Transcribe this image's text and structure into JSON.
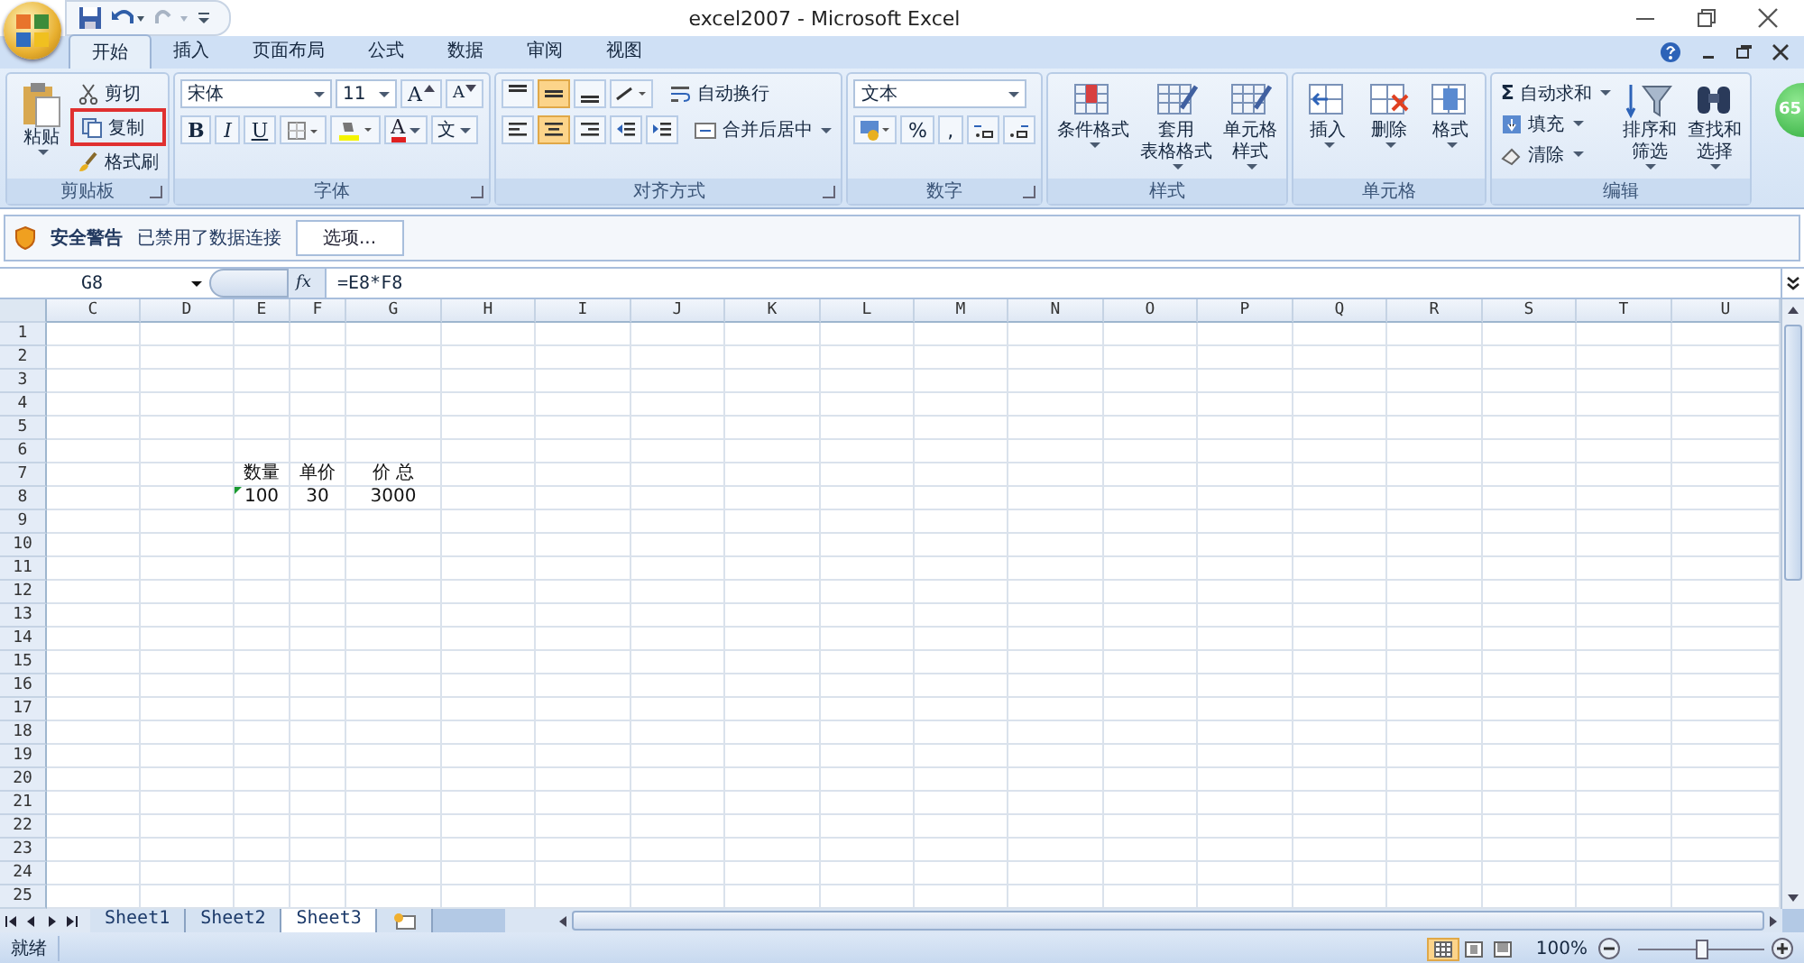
{
  "window": {
    "title": "excel2007 - Microsoft Excel"
  },
  "tabs": [
    {
      "label": "开始",
      "selected": true
    },
    {
      "label": "插入",
      "selected": false
    },
    {
      "label": "页面布局",
      "selected": false
    },
    {
      "label": "公式",
      "selected": false
    },
    {
      "label": "数据",
      "selected": false
    },
    {
      "label": "审阅",
      "selected": false
    },
    {
      "label": "视图",
      "selected": false
    }
  ],
  "ribbon": {
    "clipboard": {
      "title": "剪贴板",
      "paste": "粘贴",
      "cut": "剪切",
      "copy": "复制",
      "copy_highlighted": true,
      "format_painter": "格式刷"
    },
    "font": {
      "title": "字体",
      "font_name": "宋体",
      "font_size": "11",
      "grow": "A",
      "shrink": "A",
      "styles": [
        {
          "kind": "bold",
          "label": "B"
        },
        {
          "kind": "italic",
          "label": "I"
        },
        {
          "kind": "underline",
          "label": "U"
        }
      ],
      "font_color": "A",
      "phonetic": "文"
    },
    "alignment": {
      "title": "对齐方式",
      "vertical": [
        {
          "selected": false
        },
        {
          "selected": true
        },
        {
          "selected": false
        }
      ],
      "horizontal": [
        {
          "selected": false
        },
        {
          "selected": true
        },
        {
          "selected": false
        }
      ],
      "wrap_text": "自动换行",
      "merge_center": "合并后居中"
    },
    "number": {
      "title": "数字",
      "format": "文本",
      "percent": "%",
      "comma": ","
    },
    "styles": {
      "title": "样式",
      "buttons": [
        {
          "kind": "conditional",
          "lines": [
            "条件格式"
          ]
        },
        {
          "kind": "table",
          "lines": [
            "套用",
            "表格格式"
          ]
        },
        {
          "kind": "cell",
          "lines": [
            "单元格",
            "样式"
          ]
        }
      ]
    },
    "cells": {
      "title": "单元格",
      "buttons": [
        {
          "kind": "insert",
          "label": "插入"
        },
        {
          "kind": "delete",
          "label": "删除"
        },
        {
          "kind": "format",
          "label": "格式"
        }
      ]
    },
    "editing": {
      "title": "编辑",
      "sigma": "Σ",
      "autosum": "自动求和",
      "fill": "填充",
      "clear": "清除",
      "sort": [
        "排序和",
        "筛选"
      ],
      "find": [
        "查找和",
        "选择"
      ]
    }
  },
  "badge": "65",
  "security_bar": {
    "title": "安全警告",
    "message": "已禁用了数据连接",
    "button": "选项..."
  },
  "formula_bar": {
    "name_box": "G8",
    "fx": "fx",
    "formula": "=E8*F8"
  },
  "sheet": {
    "columns": [
      "C",
      "D",
      "E",
      "F",
      "G",
      "H",
      "I",
      "J",
      "K",
      "L",
      "M",
      "N",
      "O",
      "P",
      "Q",
      "R",
      "S",
      "T",
      "U"
    ],
    "rows": [
      {
        "label": "1"
      },
      {
        "label": "2"
      },
      {
        "label": "3"
      },
      {
        "label": "4"
      },
      {
        "label": "5"
      },
      {
        "label": "6"
      },
      {
        "label": "7",
        "cells": [
          null,
          null,
          {
            "text": "数量",
            "error_flag": false
          },
          {
            "text": "单价",
            "error_flag": false
          },
          {
            "text": "价 总",
            "error_flag": false
          }
        ]
      },
      {
        "label": "8",
        "cells": [
          null,
          null,
          {
            "text": "100",
            "error_flag": true
          },
          {
            "text": "30",
            "error_flag": false
          },
          {
            "text": "3000",
            "error_flag": false
          }
        ]
      },
      {
        "label": "9"
      },
      {
        "label": "10"
      },
      {
        "label": "11"
      },
      {
        "label": "12"
      },
      {
        "label": "13"
      },
      {
        "label": "14"
      },
      {
        "label": "15"
      },
      {
        "label": "16"
      },
      {
        "label": "17"
      },
      {
        "label": "18"
      },
      {
        "label": "19"
      },
      {
        "label": "20"
      },
      {
        "label": "21"
      },
      {
        "label": "22"
      },
      {
        "label": "23"
      },
      {
        "label": "24"
      },
      {
        "label": "25"
      }
    ]
  },
  "sheet_tabs": [
    {
      "label": "Sheet1",
      "selected": false
    },
    {
      "label": "Sheet2",
      "selected": false
    },
    {
      "label": "Sheet3",
      "selected": true
    }
  ],
  "status_bar": {
    "status": "就绪",
    "views": [
      {
        "kind": "normal",
        "selected": true
      },
      {
        "kind": "layout",
        "selected": false
      },
      {
        "kind": "break",
        "selected": false
      }
    ],
    "zoom": "100%",
    "zoom_slider": {
      "level": 0.5
    }
  }
}
